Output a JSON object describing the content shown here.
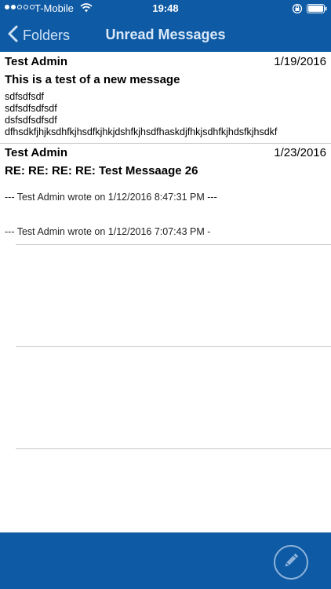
{
  "status_bar": {
    "carrier": "T-Mobile",
    "time": "19:48"
  },
  "nav": {
    "back_label": "Folders",
    "title": "Unread Messages"
  },
  "messages": [
    {
      "sender": "Test Admin",
      "date": "1/19/2016",
      "subject": "This is a test of a new message",
      "body": [
        "sdfsdfsdf",
        "sdfsdfsdfsdf",
        "dsfsdfsdfsdf",
        "dfhsdkfjhjksdhfkjhsdfkjhkjdshfkjhsdfhaskdjfhkjsdhfkjhdsfkjhsdkf"
      ]
    },
    {
      "sender": "Test Admin",
      "date": "1/23/2016",
      "subject": "RE: RE: RE: RE: Test Messaage 26",
      "quotes": [
        "--- Test Admin wrote on 1/12/2016 8:47:31 PM ---",
        "--- Test Admin wrote on 1/12/2016 7:07:43 PM -"
      ]
    }
  ],
  "toolbar": {
    "compose_icon": "pencil-icon"
  }
}
